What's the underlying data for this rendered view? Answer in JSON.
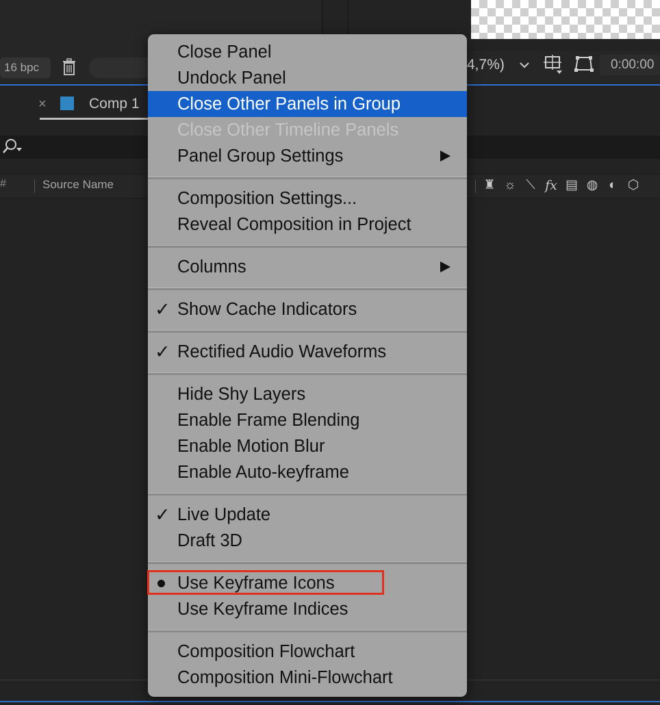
{
  "toolbar": {
    "bit_depth": "16 bpc",
    "zoom_text": "4,7%)",
    "timecode": "0:00:00"
  },
  "timeline": {
    "tab_close": "×",
    "tab_label": "Comp 1",
    "header": {
      "hash": "#",
      "source_name": "Source Name",
      "icons": [
        "shy-icon",
        "sun-icon",
        "motion-blur-icon",
        "fx-icon",
        "frame-blending-icon",
        "adjustment-icon",
        "contrast-icon",
        "3d-cube-icon"
      ]
    }
  },
  "menu": {
    "close_panel": "Close Panel",
    "undock_panel": "Undock Panel",
    "close_other_panels_in_group": "Close Other Panels in Group",
    "close_other_timeline_panels": "Close Other Timeline Panels",
    "panel_group_settings": "Panel Group Settings",
    "composition_settings": "Composition Settings...",
    "reveal_composition_in_project": "Reveal Composition in Project",
    "columns": "Columns",
    "show_cache_indicators": "Show Cache Indicators",
    "rectified_audio_waveforms": "Rectified Audio Waveforms",
    "hide_shy_layers": "Hide Shy Layers",
    "enable_frame_blending": "Enable Frame Blending",
    "enable_motion_blur": "Enable Motion Blur",
    "enable_auto_keyframe": "Enable Auto-keyframe",
    "live_update": "Live Update",
    "draft_3d": "Draft 3D",
    "use_keyframe_icons": "Use Keyframe Icons",
    "use_keyframe_indices": "Use Keyframe Indices",
    "composition_flowchart": "Composition Flowchart",
    "composition_mini_flowchart": "Composition Mini-Flowchart",
    "check_mark": "✓"
  },
  "colors": {
    "highlight": "#1560c9",
    "annotation_box": "#e0301e",
    "accent_line": "#2f6fd0",
    "comp_swatch": "#2f86c3"
  }
}
